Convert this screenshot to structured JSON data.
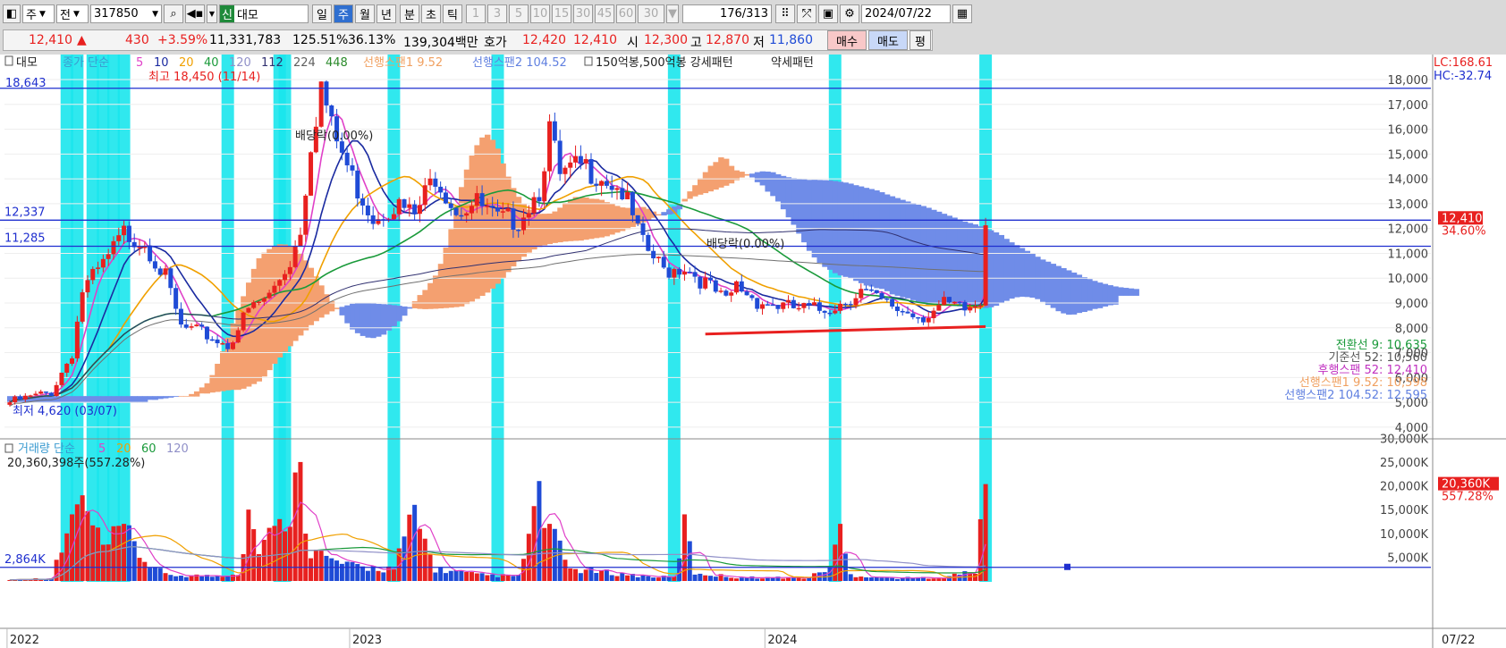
{
  "toolbar": {
    "market": "주",
    "scope": "전",
    "code": "317850",
    "badge": "신",
    "name": "대모",
    "periods": [
      "일",
      "주",
      "월",
      "년"
    ],
    "period_selected": "주",
    "intraday": [
      "분",
      "초",
      "틱"
    ],
    "minutes": [
      "1",
      "3",
      "5",
      "10",
      "15",
      "30",
      "45",
      "60"
    ],
    "minute_select": "30",
    "count": "176",
    "total": "/313",
    "date": "2024/07/22"
  },
  "quote": {
    "price": "12,410",
    "arrow": "▲",
    "change": "430",
    "change_pct": "+3.59%",
    "volume": "11,331,783",
    "vol_ratio": "125.51%",
    "turnover": "36.13%",
    "amount": "139,304백만",
    "hoga_label": "호가",
    "ask": "12,420",
    "bid": "12,410",
    "open_label": "시",
    "open": "12,300",
    "high_label": "고",
    "high": "12,870",
    "low_label": "저",
    "low": "11,860",
    "buy_label": "매수",
    "sell_label": "매도",
    "eval_label": "평"
  },
  "legend": {
    "name": "대모",
    "close_label": "종가 단순",
    "ma": [
      {
        "p": "5",
        "color": "#e040c8"
      },
      {
        "p": "10",
        "color": "#1a2aa0"
      },
      {
        "p": "20",
        "color": "#f0a000"
      },
      {
        "p": "40",
        "color": "#1a9a3a"
      },
      {
        "p": "120",
        "color": "#9090c8"
      },
      {
        "p": "112",
        "color": "#303070"
      },
      {
        "p": "224",
        "color": "#606060"
      },
      {
        "p": "448",
        "color": "#2a8a2a"
      }
    ],
    "span1": "선행스팬1 9.52",
    "span2": "선행스팬2 104.52",
    "pattern": "150억봉,500억봉 강세패턴",
    "weak": "약세패턴",
    "vol_title": "거래량 단순",
    "vol_ma": [
      "5",
      "20",
      "60",
      "120"
    ],
    "vol_value": "20,360,398주(557.28%)"
  },
  "annotations": {
    "max": "최고 18,450 (11/14)",
    "min": "최저 4,620 (03/07)",
    "div1": "배당락(0.00%)",
    "div2": "배당락(0.00%)",
    "top_left": "18,643",
    "lc": "LC:168.61",
    "hc": "HC:-32.74",
    "hline1": "12,337",
    "hline2": "11,285",
    "vol_line": "2,864K"
  },
  "ichimoku": [
    {
      "label": "전환선 9: 10,635",
      "color": "#1a9a3a"
    },
    {
      "label": "기준선 52: 10,560",
      "color": "#555555"
    },
    {
      "label": "후행스팬 52: 12,410",
      "color": "#c030c0"
    },
    {
      "label": "선행스팬1 9.52: 10,598",
      "color": "#f0a060"
    },
    {
      "label": "선행스팬2 104.52: 12,595",
      "color": "#6080e0"
    }
  ],
  "price_tag": {
    "value": "12,410",
    "pct": "34.60%"
  },
  "vol_tag": {
    "value": "20,360K",
    "pct": "557.28%"
  },
  "colors": {
    "up": "#e8201f",
    "down": "#1f4bd6",
    "highlight": "#19e6ec",
    "cloud_up": "#f4a070",
    "cloud_down": "#6f8ce8"
  },
  "chart_data": {
    "type": "candlestick",
    "x_labels": [
      "2022",
      "2023",
      "2024",
      "07/22"
    ],
    "y_ticks": [
      "18,000",
      "17,000",
      "16,000",
      "15,000",
      "14,000",
      "13,000",
      "12,000",
      "11,000",
      "10,000",
      "9,000",
      "8,000",
      "7,000",
      "6,000",
      "5,000",
      "4,000"
    ],
    "vol_ticks": [
      "30,000K",
      "25,000K",
      "20,000K",
      "15,000K",
      "10,000K",
      "5,000K"
    ],
    "ylim": [
      3600,
      18900
    ],
    "vol_ylim": [
      0,
      34000
    ],
    "price_anchors": [
      [
        0,
        5000
      ],
      [
        4,
        5200
      ],
      [
        8,
        5400
      ],
      [
        12,
        7000
      ],
      [
        14,
        9500
      ],
      [
        18,
        10500
      ],
      [
        22,
        11800
      ],
      [
        26,
        11500
      ],
      [
        30,
        10000
      ],
      [
        33,
        8000
      ],
      [
        38,
        7700
      ],
      [
        42,
        7300
      ],
      [
        46,
        8700
      ],
      [
        50,
        9300
      ],
      [
        54,
        10700
      ],
      [
        56,
        12000
      ],
      [
        58,
        15500
      ],
      [
        60,
        17800
      ],
      [
        62,
        16000
      ],
      [
        66,
        14000
      ],
      [
        70,
        12500
      ],
      [
        74,
        13000
      ],
      [
        78,
        12500
      ],
      [
        82,
        14200
      ],
      [
        86,
        12800
      ],
      [
        90,
        13000
      ],
      [
        94,
        12300
      ],
      [
        98,
        12400
      ],
      [
        102,
        13600
      ],
      [
        104,
        16000
      ],
      [
        106,
        14000
      ],
      [
        110,
        14500
      ],
      [
        114,
        14200
      ],
      [
        118,
        13500
      ],
      [
        122,
        11300
      ],
      [
        126,
        10300
      ],
      [
        130,
        10500
      ],
      [
        134,
        9800
      ],
      [
        138,
        9000
      ],
      [
        140,
        9700
      ],
      [
        144,
        9100
      ],
      [
        150,
        8800
      ],
      [
        156,
        8700
      ],
      [
        160,
        9000
      ],
      [
        164,
        9500
      ],
      [
        168,
        9000
      ],
      [
        172,
        8700
      ],
      [
        176,
        8500
      ],
      [
        180,
        8900
      ],
      [
        184,
        8700
      ],
      [
        187,
        9000
      ],
      [
        188,
        12400
      ]
    ],
    "volume_anchors": [
      [
        0,
        300
      ],
      [
        8,
        700
      ],
      [
        12,
        14000
      ],
      [
        14,
        18000
      ],
      [
        18,
        8000
      ],
      [
        22,
        12000
      ],
      [
        26,
        5000
      ],
      [
        30,
        1500
      ],
      [
        40,
        1200
      ],
      [
        44,
        2000
      ],
      [
        46,
        15000
      ],
      [
        48,
        9000
      ],
      [
        52,
        13000
      ],
      [
        56,
        25000
      ],
      [
        58,
        8000
      ],
      [
        62,
        5000
      ],
      [
        66,
        3500
      ],
      [
        74,
        3000
      ],
      [
        78,
        16000
      ],
      [
        82,
        3000
      ],
      [
        90,
        1500
      ],
      [
        98,
        1200
      ],
      [
        102,
        21000
      ],
      [
        104,
        12000
      ],
      [
        108,
        3000
      ],
      [
        116,
        2000
      ],
      [
        122,
        1200
      ],
      [
        128,
        900
      ],
      [
        130,
        14000
      ],
      [
        132,
        2000
      ],
      [
        140,
        900
      ],
      [
        154,
        800
      ],
      [
        158,
        3500
      ],
      [
        160,
        12000
      ],
      [
        162,
        1500
      ],
      [
        170,
        700
      ],
      [
        180,
        900
      ],
      [
        186,
        2500
      ],
      [
        188,
        20360
      ]
    ],
    "highlight_index": [
      11,
      13,
      16,
      18,
      20,
      22,
      42,
      52,
      53,
      74,
      94,
      128,
      159,
      188
    ],
    "bars": 189
  }
}
